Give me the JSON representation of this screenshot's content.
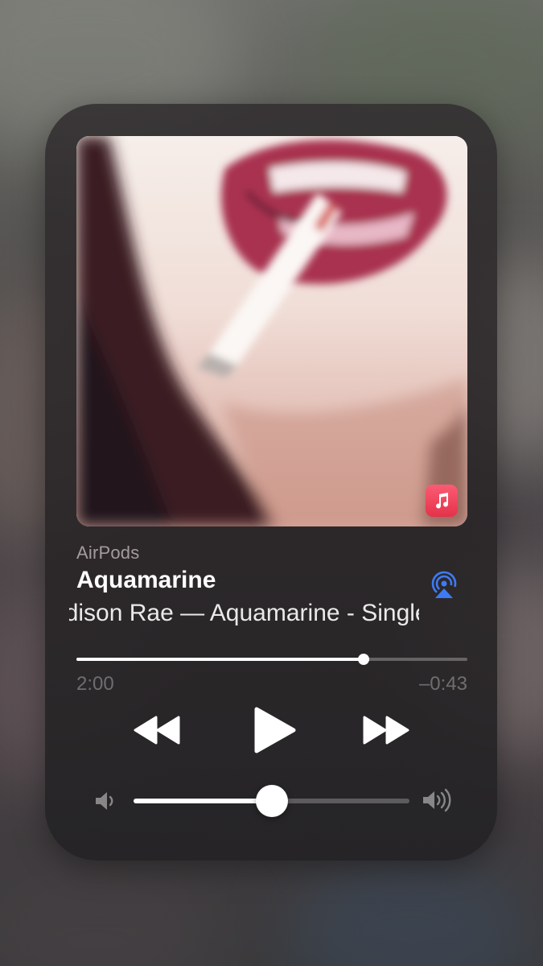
{
  "now_playing": {
    "device": "AirPods",
    "title": "Aquamarine",
    "subtitle": "Addison Rae — Aquamarine - Single",
    "elapsed": "2:00",
    "remaining": "–0:43",
    "progress_fraction": 0.735,
    "volume_fraction": 0.5
  },
  "icons": {
    "app_badge": "apple-music-icon",
    "output": "airplay-audio-icon",
    "previous": "rewind-icon",
    "play": "play-icon",
    "next": "fast-forward-icon",
    "volume_min": "speaker-low-icon",
    "volume_max": "speaker-high-icon"
  },
  "colors": {
    "accent_airplay": "#3d7bf5",
    "music_badge": "#f0485e",
    "card_bg": "#2d292b"
  }
}
